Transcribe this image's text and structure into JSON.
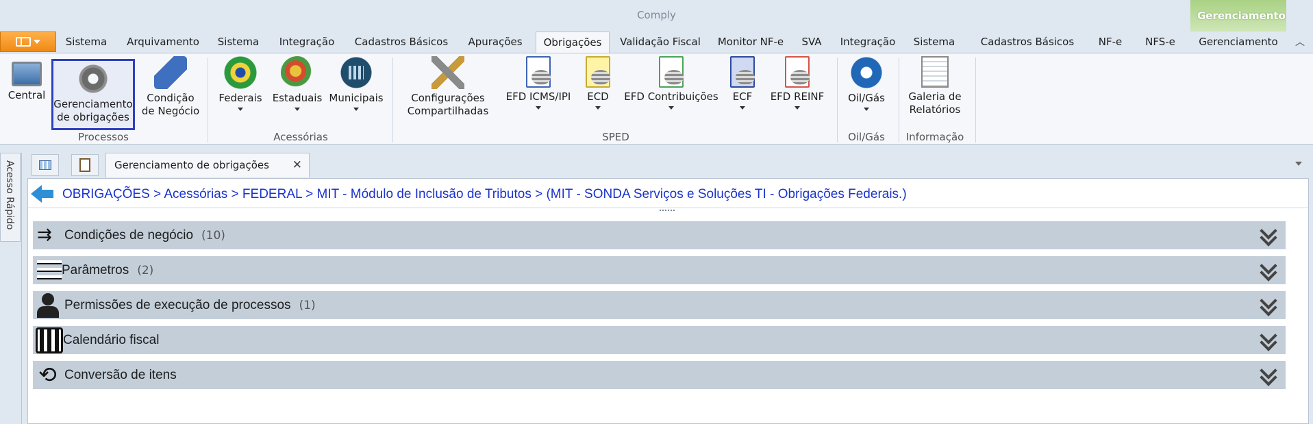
{
  "window": {
    "title": "Comply",
    "context_tab": "Gerenciamento"
  },
  "tabs": [
    "Sistema",
    "Arquivamento",
    "Sistema",
    "Integração",
    "Cadastros Básicos",
    "Apurações",
    "Obrigações",
    "Validação Fiscal",
    "Monitor NF-e",
    "SVA",
    "Integração",
    "Sistema",
    "Cadastros Básicos",
    "NF-e",
    "NFS-e",
    "Gerenciamento"
  ],
  "active_tab": "Obrigações",
  "ribbon": {
    "buttons": [
      {
        "name": "central",
        "label": "Central",
        "icon": "monitor-icon"
      },
      {
        "name": "gerenciamento",
        "label": "Gerenciamento\nde obrigações",
        "icon": "gear-icon"
      },
      {
        "name": "condicao",
        "label": "Condição\nde Negócio",
        "icon": "feather-icon"
      },
      {
        "name": "federais",
        "label": "Federais",
        "icon": "brazil-flag-icon"
      },
      {
        "name": "estaduais",
        "label": "Estaduais",
        "icon": "map-icon"
      },
      {
        "name": "municipais",
        "label": "Municipais",
        "icon": "city-icon"
      },
      {
        "name": "configuracoes",
        "label": "Configurações\nCompartilhadas",
        "icon": "tools-icon"
      },
      {
        "name": "efd-icms",
        "label": "EFD ICMS/IPI",
        "icon": "document-icon"
      },
      {
        "name": "ecd",
        "label": "ECD",
        "icon": "document-icon"
      },
      {
        "name": "efd-contrib",
        "label": "EFD Contribuições",
        "icon": "document-icon"
      },
      {
        "name": "ecf",
        "label": "ECF",
        "icon": "document-icon"
      },
      {
        "name": "efd-reinf",
        "label": "EFD REINF",
        "icon": "document-icon"
      },
      {
        "name": "oil-gas",
        "label": "Oil/Gás",
        "icon": "fuel-icon"
      },
      {
        "name": "galeria",
        "label": "Galeria de\nRelatórios",
        "icon": "report-icon"
      }
    ],
    "groups": [
      "Processos",
      "Acessórias",
      "SPED",
      "Oil/Gás",
      "Informação"
    ]
  },
  "leftrail": {
    "quick_access": "Acesso Rápido"
  },
  "doc_tab": {
    "title": "Gerenciamento de obrigações",
    "close": "✕"
  },
  "breadcrumb": "OBRIGAÇÕES > Acessórias > FEDERAL > MIT - Módulo de Inclusão de Tributos > (MIT - SONDA Serviços e Soluções TI - Obrigações Federais.)",
  "sections": [
    {
      "title": "Condições de negócio",
      "count": "(10)",
      "icon": "flow-arrows-icon"
    },
    {
      "title": "Parâmetros",
      "count": "(2)",
      "icon": "list-icon"
    },
    {
      "title": "Permissões de execução de processos",
      "count": "(1)",
      "icon": "user-icon"
    },
    {
      "title": "Calendário fiscal",
      "count": "",
      "icon": "calendar-icon"
    },
    {
      "title": "Conversão de itens",
      "count": "",
      "icon": "refresh-icon"
    }
  ]
}
